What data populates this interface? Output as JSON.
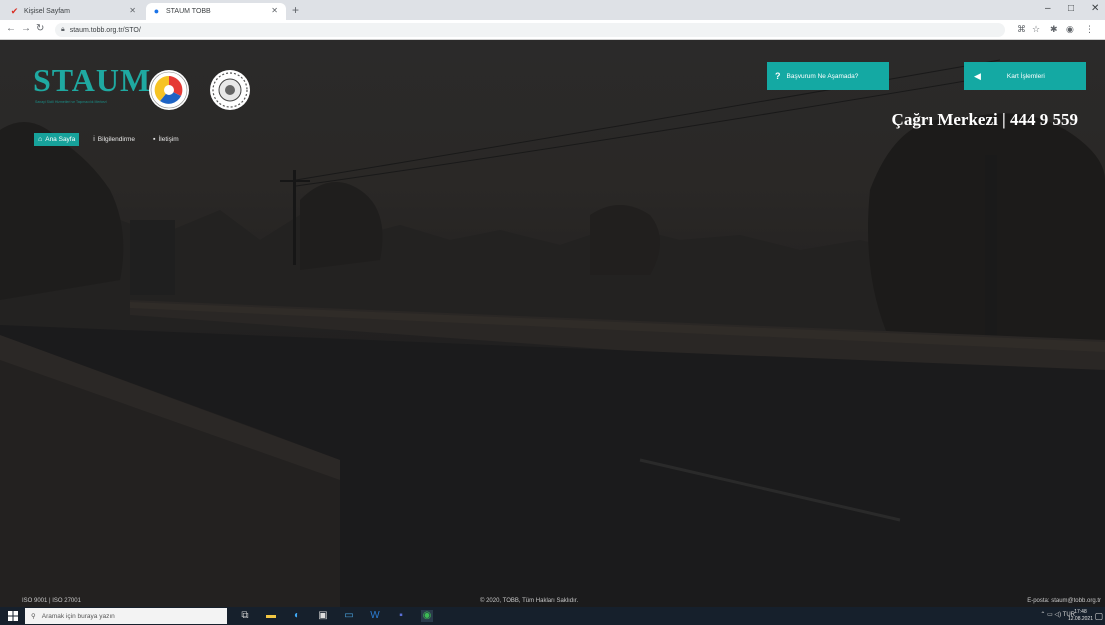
{
  "browser": {
    "tabs": [
      {
        "title": "Kişisel Sayfam",
        "favicon": "checkmark-icon"
      },
      {
        "title": "STAUM TOBB",
        "favicon": "tobb-icon"
      }
    ],
    "url": "staum.tobb.org.tr/STO/"
  },
  "header": {
    "logo_text": "STAUM",
    "logo_subtitle": "Sanayi Sicili Hizmetleri ve Taşımacılık Merkezi",
    "help_button": "Başvurum Ne Aşamada?",
    "card_button": "Kart İşlemleri",
    "call_center": "Çağrı Merkezi | 444 9 559"
  },
  "nav": {
    "items": [
      {
        "label": "Ana Sayfa",
        "icon": "home-icon"
      },
      {
        "label": "Bilgilendirme",
        "icon": "info-icon"
      },
      {
        "label": "İletişim",
        "icon": "contact-icon"
      }
    ]
  },
  "footer": {
    "left": "ISO 9001 | ISO 27001",
    "center": "© 2020, TOBB, Tüm Hakları Saklıdır.",
    "right": "E-posta: staum@tobb.org.tr"
  },
  "taskbar": {
    "search_placeholder": "Aramak için buraya yazın",
    "tray_text": "TUR",
    "time": "17:48",
    "date": "12.08.2021"
  },
  "colors": {
    "accent": "#14a9a3",
    "logo": "#1fa9a1",
    "taskbar": "#16202c"
  }
}
